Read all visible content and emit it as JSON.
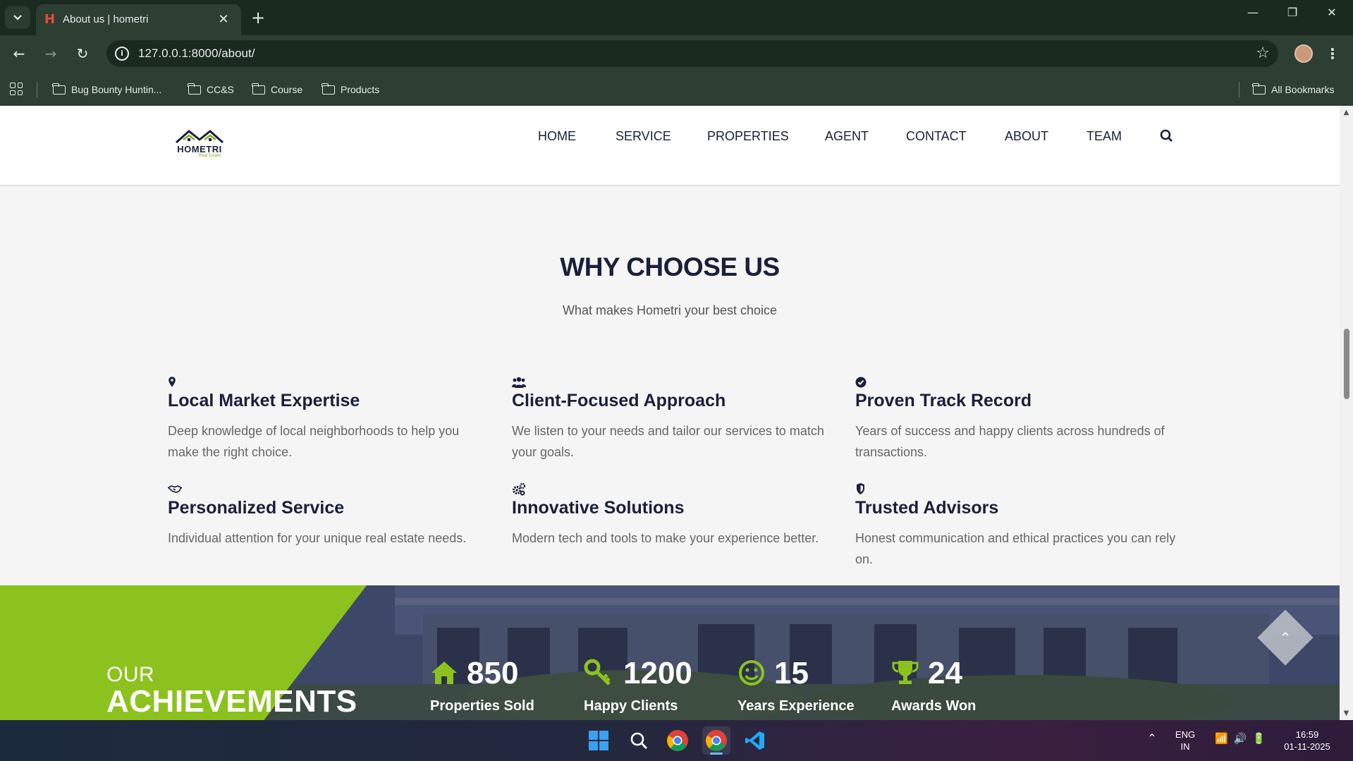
{
  "browser": {
    "tab_title": "About us | hometri",
    "favicon_letter": "H",
    "url": "127.0.0.1:8000/about/",
    "bookmarks": [
      "Bug Bounty Huntin...",
      "CC&S",
      "Course",
      "Products"
    ],
    "all_bookmarks_label": "All Bookmarks"
  },
  "site": {
    "logo_text": "HOMETRI",
    "logo_sub": "Real Estate",
    "nav": [
      "HOME",
      "SERVICE",
      "PROPERTIES",
      "AGENT",
      "CONTACT",
      "ABOUT",
      "TEAM"
    ]
  },
  "why": {
    "title": "WHY CHOOSE US",
    "subtitle": "What makes Hometri your best choice",
    "features": [
      {
        "icon": "map-marker-icon",
        "title": "Local Market Expertise",
        "text": "Deep knowledge of local neighborhoods to help you make the right choice."
      },
      {
        "icon": "users-icon",
        "title": "Client-Focused Approach",
        "text": "We listen to your needs and tailor our services to match your goals."
      },
      {
        "icon": "check-circle-icon",
        "title": "Proven Track Record",
        "text": "Years of success and happy clients across hundreds of transactions."
      },
      {
        "icon": "handshake-icon",
        "title": "Personalized Service",
        "text": "Individual attention for your unique real estate needs."
      },
      {
        "icon": "cogs-icon",
        "title": "Innovative Solutions",
        "text": "Modern tech and tools to make your experience better."
      },
      {
        "icon": "shield-icon",
        "title": "Trusted Advisors",
        "text": "Honest communication and ethical practices you can rely on."
      }
    ]
  },
  "achievements": {
    "heading_our": "OUR",
    "heading_title": "ACHIEVEMENTS",
    "stats": [
      {
        "icon": "home-icon",
        "value": "850",
        "label": "Properties Sold"
      },
      {
        "icon": "key-icon",
        "value": "1200",
        "label": "Happy Clients"
      },
      {
        "icon": "smile-icon",
        "value": "15",
        "label": "Years Experience"
      },
      {
        "icon": "trophy-icon",
        "value": "24",
        "label": "Awards Won"
      }
    ],
    "accent_color": "#8cc21e"
  },
  "taskbar": {
    "lang_line1": "ENG",
    "lang_line2": "IN",
    "time": "16:59",
    "date": "01-11-2025"
  }
}
